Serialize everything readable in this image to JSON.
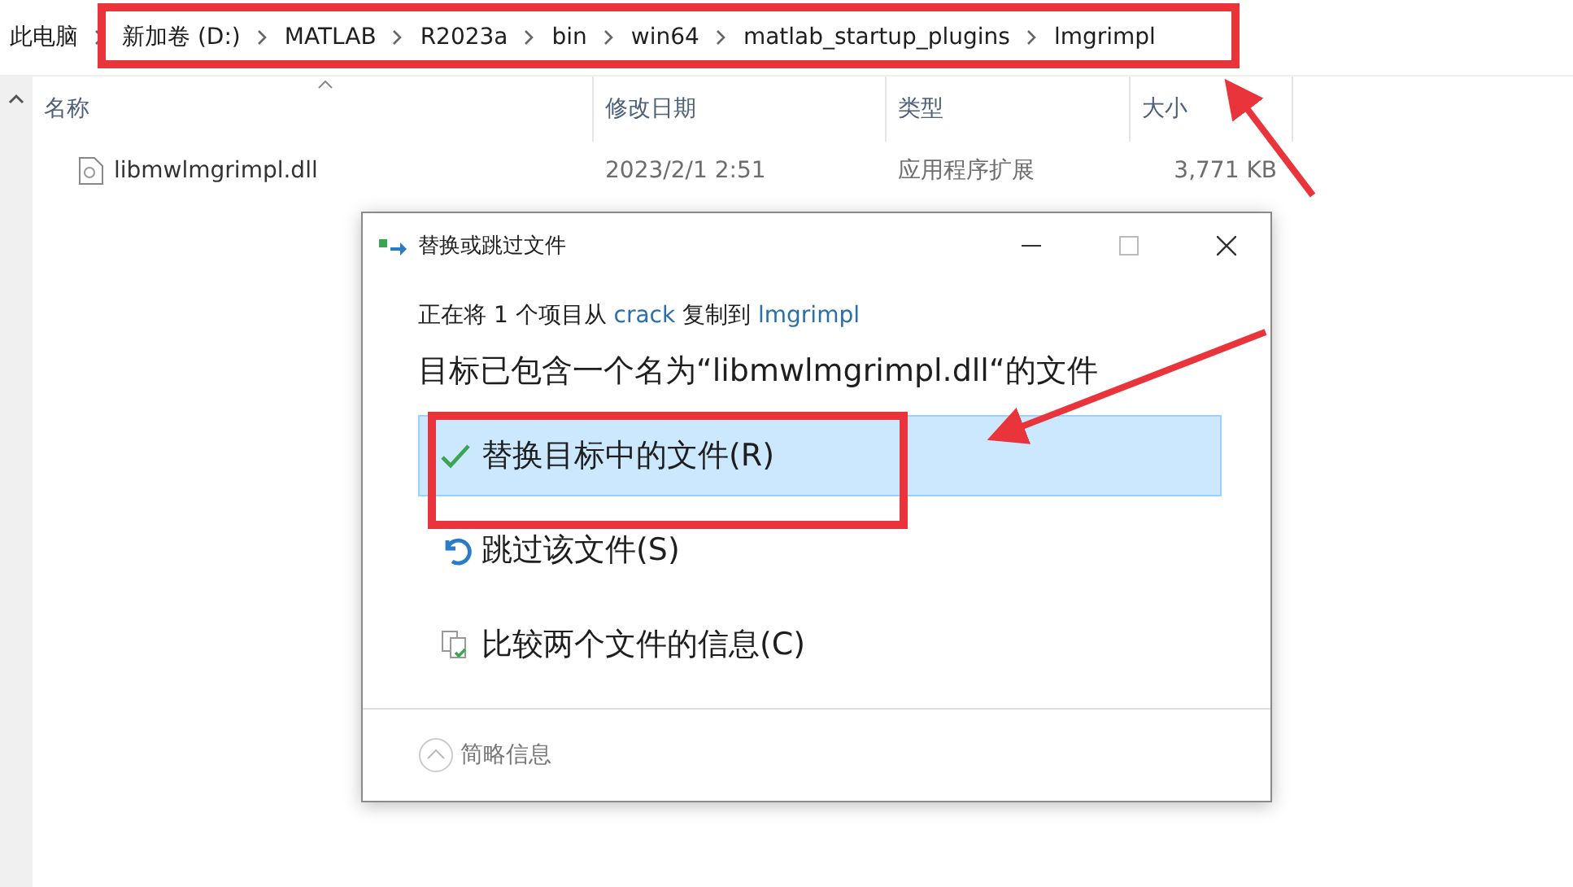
{
  "breadcrumb": [
    "此电脑",
    "新加卷 (D:)",
    "MATLAB",
    "R2023a",
    "bin",
    "win64",
    "matlab_startup_plugins",
    "lmgrimpl"
  ],
  "table": {
    "columns": [
      "名称",
      "修改日期",
      "类型",
      "大小"
    ],
    "rows": [
      {
        "name": "libmwlmgrimpl.dll",
        "date": "2023/2/1 2:51",
        "type": "应用程序扩展",
        "size": "3,771 KB"
      }
    ]
  },
  "dialog": {
    "title": "替换或跳过文件",
    "copy_line": {
      "prefix": "正在将 1 个项目从 ",
      "source": "crack",
      "middle": " 复制到 ",
      "target": "lmgrimpl"
    },
    "message": "目标已包含一个名为“libmwlmgrimpl.dll“的文件",
    "options": [
      {
        "kind": "replace",
        "label": "替换目标中的文件(R)",
        "selected": true
      },
      {
        "kind": "skip",
        "label": "跳过该文件(S)",
        "selected": false
      },
      {
        "kind": "compare",
        "label": "比较两个文件的信息(C)",
        "selected": false
      }
    ],
    "details": "简略信息"
  }
}
